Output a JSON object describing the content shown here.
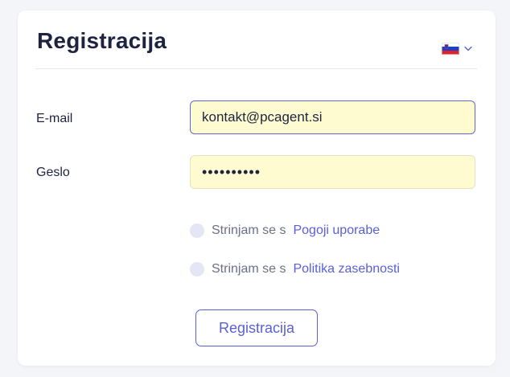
{
  "form": {
    "title": "Registracija",
    "language": {
      "flag_icon": "slovenia-flag-icon",
      "dropdown_icon": "chevron-down-icon"
    },
    "email": {
      "label": "E-mail",
      "value": "kontakt@pcagent.si"
    },
    "password": {
      "label": "Geslo",
      "value": "••••••••••"
    },
    "terms": {
      "prefix": "Strinjam se s",
      "link": "Pogoji uporabe",
      "checked": false
    },
    "privacy": {
      "prefix": "Strinjam se s",
      "link": "Politika zasebnosti",
      "checked": false
    },
    "submit_label": "Registracija"
  },
  "colors": {
    "accent": "#5a5fd6",
    "autofill_bg": "#fefbd0",
    "text": "#1e2340",
    "checkbox_bg": "#e3e7f4"
  }
}
